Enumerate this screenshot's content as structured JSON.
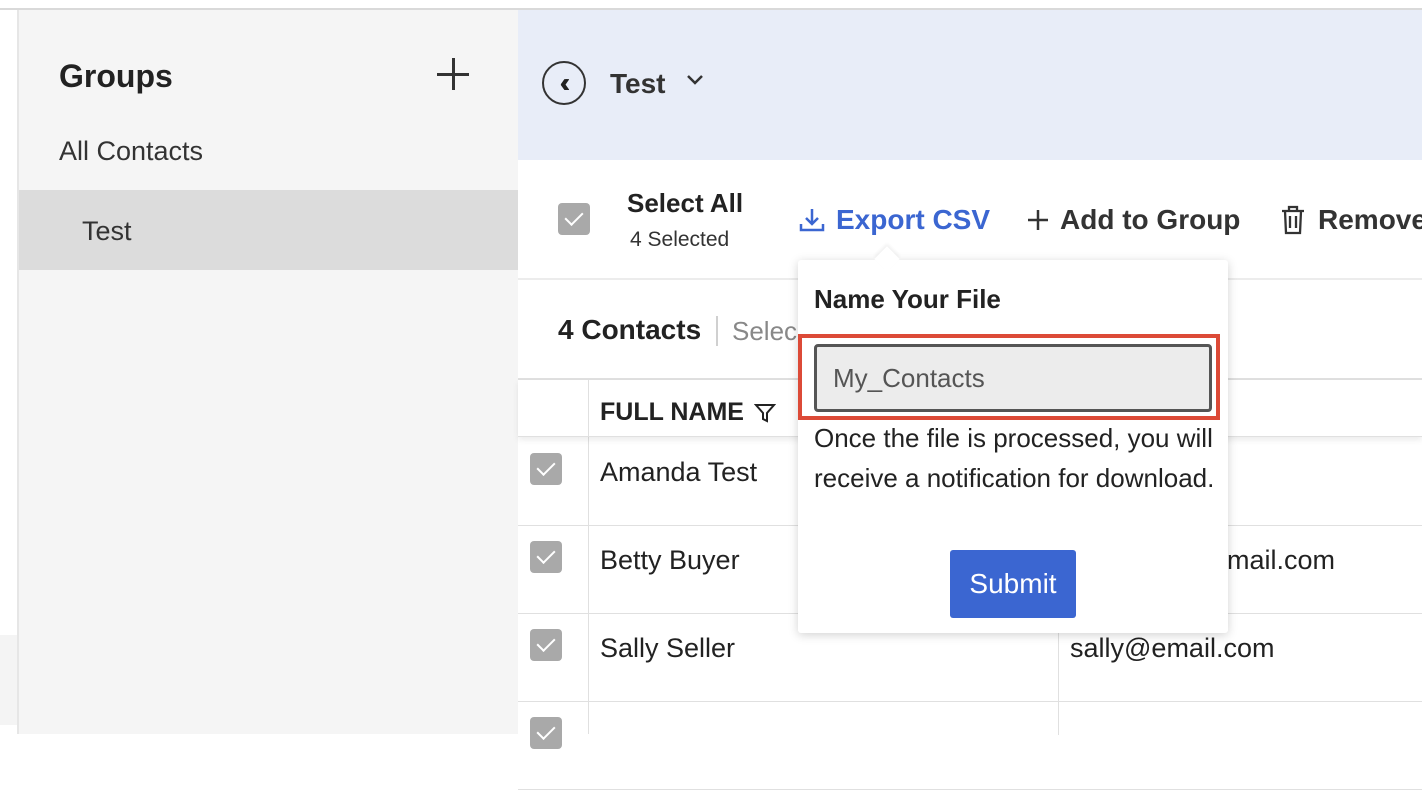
{
  "sidebar": {
    "title": "Groups",
    "all_contacts": "All Contacts",
    "items": [
      {
        "label": "Test"
      }
    ]
  },
  "header": {
    "title": "Test"
  },
  "toolbar": {
    "select_all": "Select All",
    "selected_count": "4 Selected",
    "export_csv": "Export CSV",
    "add_to_group": "Add to Group",
    "remove": "Remove"
  },
  "list": {
    "contacts_count": "4 Contacts",
    "select_hint": "Selec"
  },
  "table": {
    "columns": {
      "full_name": "FULL NAME"
    },
    "rows": [
      {
        "name": "Amanda Test",
        "email": ""
      },
      {
        "name": "Betty Buyer",
        "email": "email.com"
      },
      {
        "name": "Sally Seller",
        "email": "sally@email.com"
      },
      {
        "name": "",
        "email": ""
      }
    ]
  },
  "popover": {
    "title": "Name Your File",
    "input_value": "My_Contacts",
    "message": "Once the file is processed, you will receive a notification for download.",
    "submit": "Submit"
  },
  "colors": {
    "accent": "#3b66d1",
    "highlight": "#dc4a37",
    "header_bg": "#e8edf8"
  }
}
